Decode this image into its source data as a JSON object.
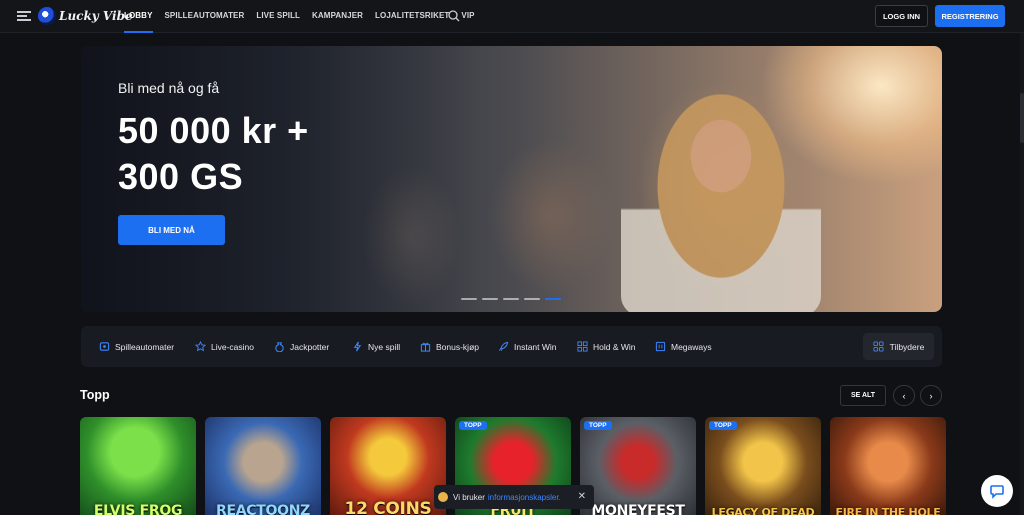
{
  "header": {
    "logo_text": "Lucky Vibe",
    "nav": [
      "LOBBY",
      "SPILLEAUTOMATER",
      "LIVE SPILL",
      "KAMPANJER",
      "LOJALITETSRIKET",
      "VIP"
    ],
    "login_label": "LOGG INN",
    "register_label": "REGISTRERING"
  },
  "hero": {
    "subtitle": "Bli med nå og få",
    "title_line1": "50 000 kr +",
    "title_line2": "300 GS",
    "cta_label": "BLI MED NÅ",
    "slides": 5,
    "active_slide": 5
  },
  "categories": {
    "items": [
      {
        "label": "Spilleautomater",
        "icon": "slot-machine-icon"
      },
      {
        "label": "Live-casino",
        "icon": "star-icon"
      },
      {
        "label": "Jackpotter",
        "icon": "moneybag-icon"
      },
      {
        "label": "Nye spill",
        "icon": "lightning-icon"
      },
      {
        "label": "Bonus-kjøp",
        "icon": "gift-icon"
      },
      {
        "label": "Instant Win",
        "icon": "rocket-icon"
      },
      {
        "label": "Hold & Win",
        "icon": "grid-icon"
      },
      {
        "label": "Megaways",
        "icon": "slot-icon"
      }
    ],
    "providers_label": "Tilbydere"
  },
  "top": {
    "title": "Topp",
    "see_all_label": "SE ALT",
    "games": [
      {
        "title": "ELVIS FROG",
        "badge": ""
      },
      {
        "title": "REACTOONZ",
        "badge": ""
      },
      {
        "title": "12 COINS",
        "badge": ""
      },
      {
        "title": "FRUIT",
        "badge": "TOPP"
      },
      {
        "title": "MONEYFEST",
        "badge": "TOPP"
      },
      {
        "title": "LEGACY OF DEAD",
        "badge": "TOPP"
      },
      {
        "title": "FIRE IN THE HOLE",
        "badge": ""
      }
    ]
  },
  "cookie_toast": {
    "text": "Vi bruker",
    "link": "informasjonskapsler."
  },
  "colors": {
    "accent": "#1d6ff2",
    "background": "#0f1115",
    "panel": "#181b21"
  }
}
